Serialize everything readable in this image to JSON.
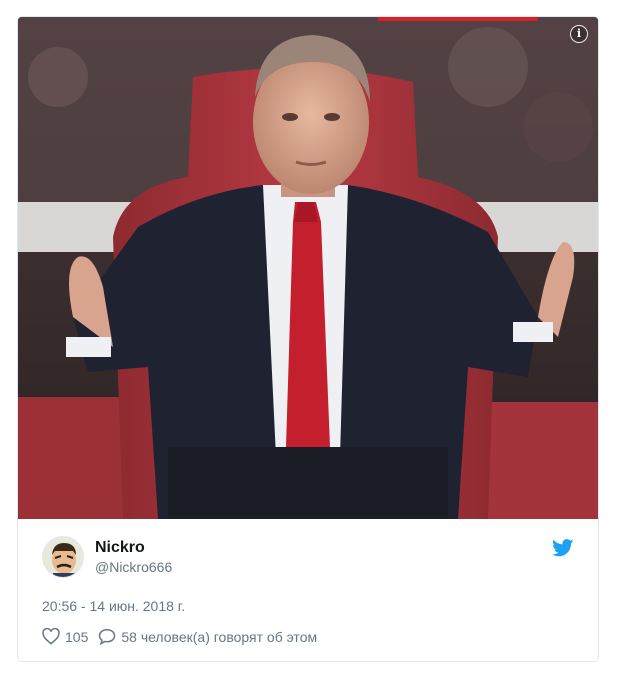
{
  "tweet": {
    "author": {
      "display_name": "Nickro",
      "handle": "@Nickro666"
    },
    "timestamp": "20:56 - 14 июн. 2018 г.",
    "likes": "105",
    "replies_text": "58 человек(а) говорят об этом"
  },
  "icons": {
    "info": "info-icon",
    "bird": "twitter-bird-icon",
    "heart": "heart-icon",
    "reply": "speech-bubble-icon"
  },
  "colors": {
    "brand_blue": "#1da1f2",
    "secondary_text": "#657786",
    "border": "#e1e8ed"
  }
}
